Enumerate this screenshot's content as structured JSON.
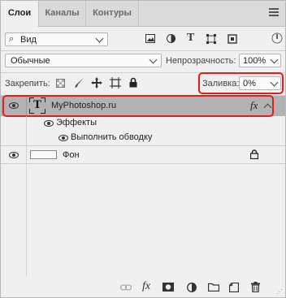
{
  "tabs": [
    {
      "label": "Слои",
      "active": true
    },
    {
      "label": "Каналы",
      "active": false
    },
    {
      "label": "Контуры",
      "active": false
    }
  ],
  "filter": {
    "kind_value": "Вид",
    "icons": [
      "image-filter-icon",
      "adjustment-filter-icon",
      "type-filter-icon",
      "shape-filter-icon",
      "smart-object-filter-icon"
    ]
  },
  "blend": {
    "mode_value": "Обычные",
    "opacity_label": "Непрозрачность:",
    "opacity_value": "100%"
  },
  "lock": {
    "label": "Закрепить:",
    "fill_label": "Заливка:",
    "fill_value": "0%"
  },
  "layers": [
    {
      "name": "MyPhotoshop.ru",
      "type": "text",
      "thumb_glyph": "T",
      "fx": "fx",
      "selected": true
    },
    {
      "name": "Эффекты",
      "type": "effects-group"
    },
    {
      "name": "Выполнить обводку",
      "type": "effect"
    },
    {
      "name": "Фон",
      "type": "background",
      "locked": true
    }
  ],
  "colors": {
    "highlight": "#e01e1e",
    "selected_row": "#b2b2b2"
  }
}
